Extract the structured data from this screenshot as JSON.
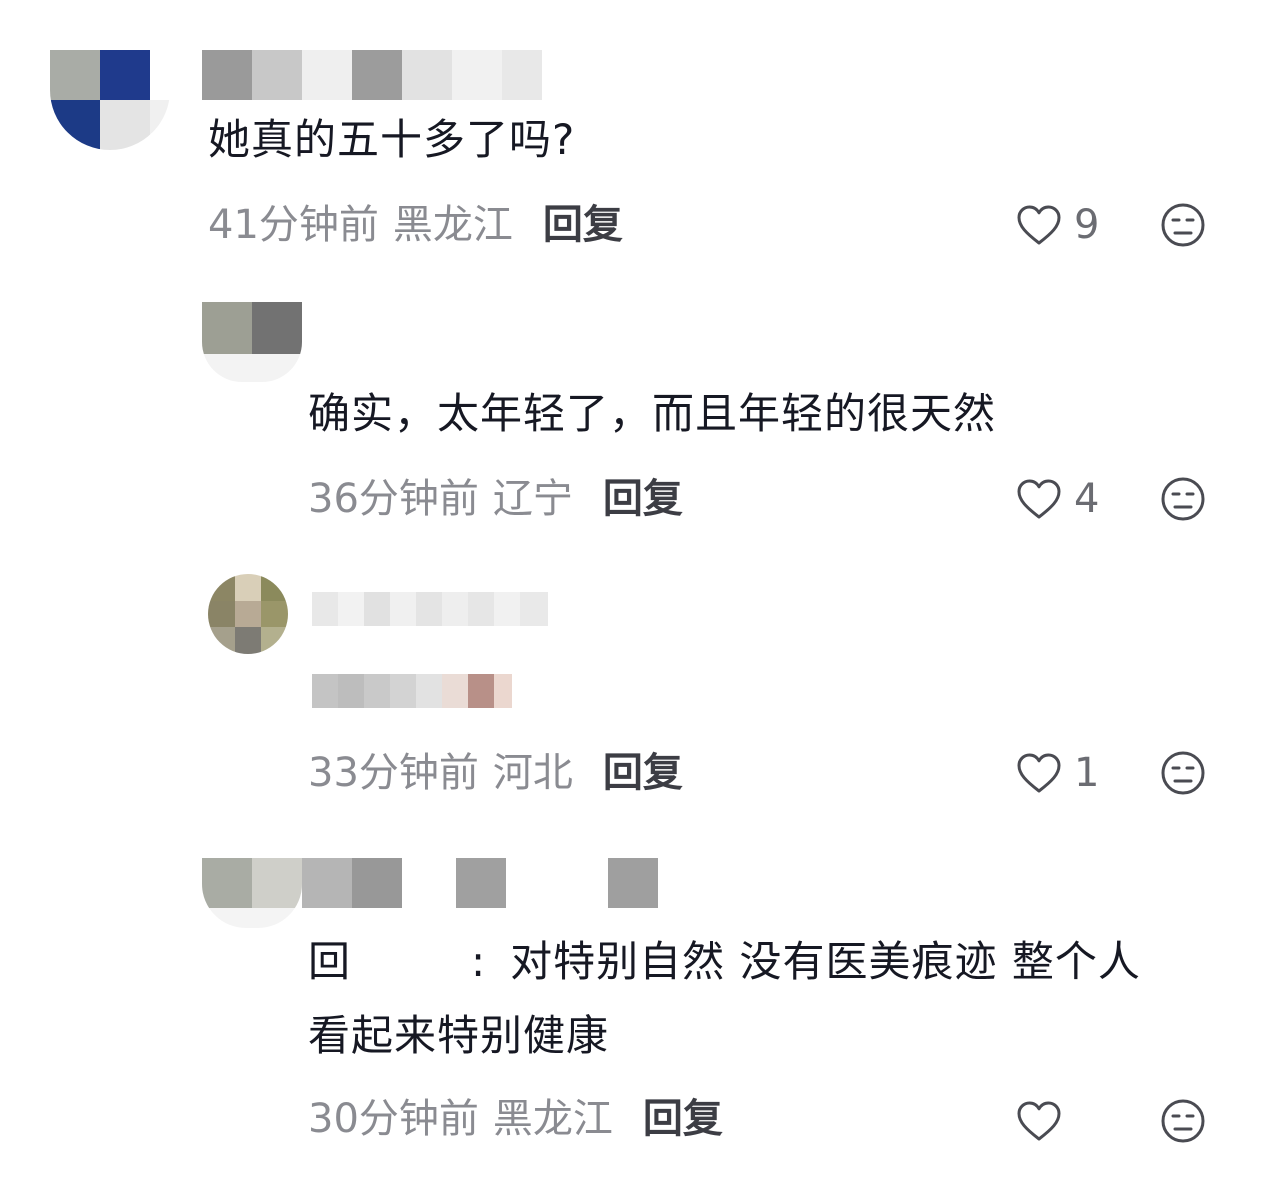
{
  "comments": [
    {
      "text": "她真的五十多了吗?",
      "time": "41分钟前",
      "region": "黑龙江",
      "reply_label": "回复",
      "likes": "9"
    },
    {
      "text": "确实，太年轻了，而且年轻的很天然",
      "time": "36分钟前",
      "region": "辽宁",
      "reply_label": "回复",
      "likes": "4"
    },
    {
      "time": "33分钟前",
      "region": "河北",
      "reply_label": "回复",
      "likes": "1"
    },
    {
      "reply_prefix": "回",
      "colon": ":",
      "text_line1": "对特别自然 没有医美痕迹 整个人",
      "text_line2": "看起来特别健康",
      "time": "30分钟前",
      "region": "黑龙江",
      "reply_label": "回复"
    }
  ],
  "icons": {
    "like": "heart-outline-icon",
    "dislike": "meh-face-icon"
  },
  "colors": {
    "text": "#161823",
    "meta": "#8a8b91",
    "reply": "#3c3d44",
    "icon": "#4a4b52"
  }
}
